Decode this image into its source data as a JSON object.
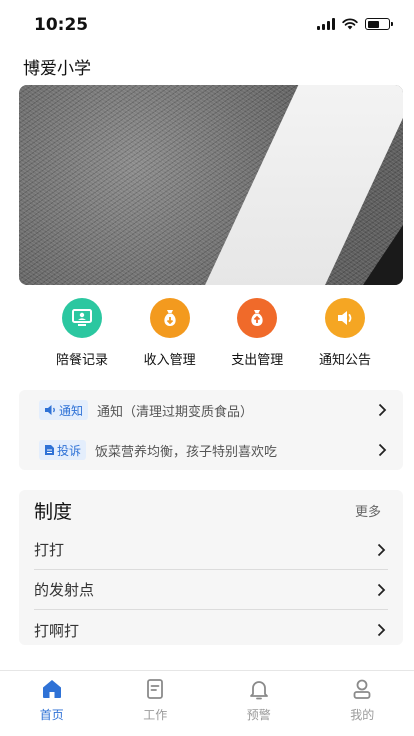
{
  "status_bar": {
    "time": "10:25"
  },
  "header": {
    "school_name": "博爱小学"
  },
  "quick_actions": [
    {
      "label": "陪餐记录",
      "icon": "monitor-icon",
      "color": "#2bc7a0"
    },
    {
      "label": "收入管理",
      "icon": "money-bag-in-icon",
      "color": "#f39a1e"
    },
    {
      "label": "支出管理",
      "icon": "money-bag-out-icon",
      "color": "#f06a2a"
    },
    {
      "label": "通知公告",
      "icon": "speaker-icon",
      "color": "#f5a623"
    }
  ],
  "notices": [
    {
      "tag": "通知",
      "text": "通知（清理过期变质食品）",
      "icon": "speaker-icon"
    },
    {
      "tag": "投诉",
      "text": "饭菜营养均衡，孩子特别喜欢吃",
      "icon": "document-icon"
    }
  ],
  "rules": {
    "title": "制度",
    "more": "更多",
    "items": [
      "打打",
      "的发射点",
      "打啊打"
    ]
  },
  "tabbar": {
    "active_color": "#2f72d6",
    "inactive_color": "#9a9a9a",
    "items": [
      {
        "label": "首页",
        "icon": "home-icon",
        "active": true
      },
      {
        "label": "工作",
        "icon": "clipboard-icon",
        "active": false
      },
      {
        "label": "预警",
        "icon": "bell-icon",
        "active": false
      },
      {
        "label": "我的",
        "icon": "user-icon",
        "active": false
      }
    ]
  }
}
